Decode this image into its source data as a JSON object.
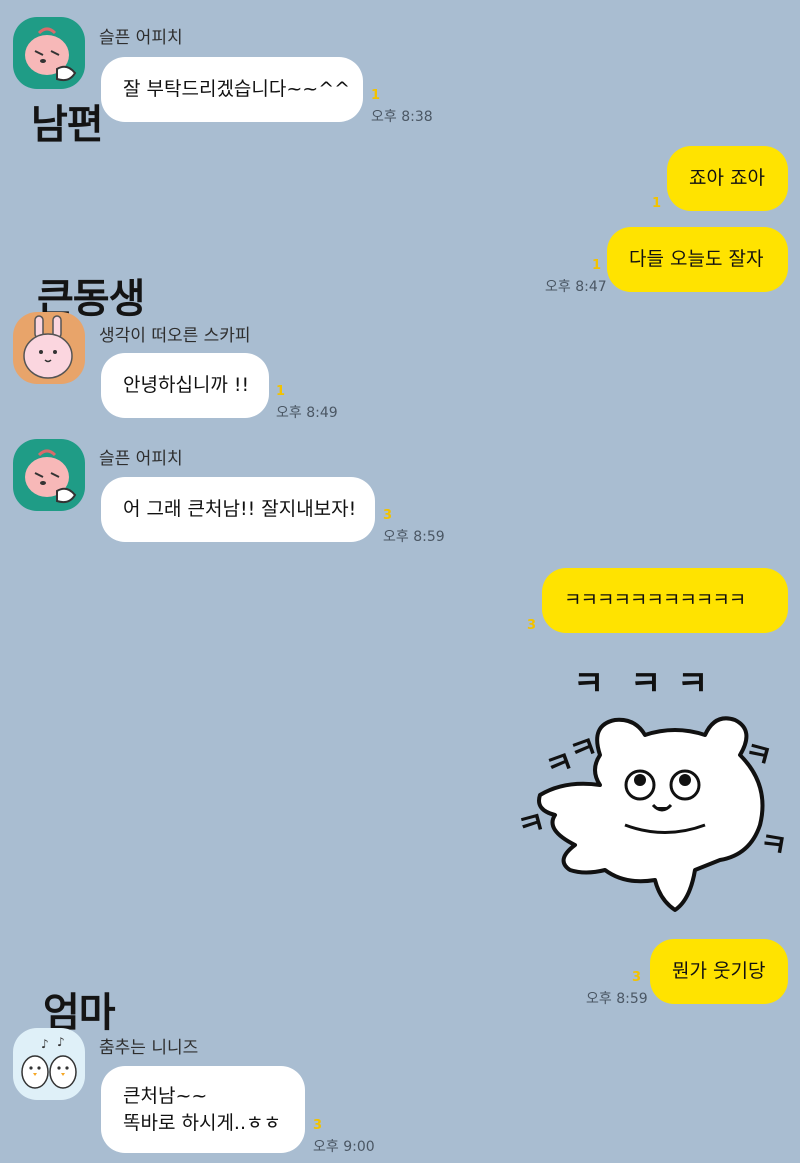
{
  "labels": {
    "husband": "남편",
    "older_sibling": "큰동생",
    "mom": "엄마"
  },
  "messages": {
    "m1": {
      "sender": "슬픈 어피치",
      "text": "잘 부탁드리겠습니다~~^^",
      "unread": "1",
      "time": "오후 8:38"
    },
    "m2": {
      "text": "죠아 죠아",
      "unread": "1"
    },
    "m3": {
      "text": "다들 오늘도 잘자",
      "unread": "1",
      "time": "오후 8:47"
    },
    "m4": {
      "sender": "생각이 떠오른 스카피",
      "text": "안녕하십니까 !!",
      "unread": "1",
      "time": "오후 8:49"
    },
    "m5": {
      "sender": "슬픈 어피치",
      "text": "어 그래 큰처남!! 잘지내보자!",
      "unread": "3",
      "time": "오후 8:59"
    },
    "m6": {
      "text": "ㅋㅋㅋㅋㅋㅋㅋㅋㅋㅋㅋ",
      "unread": "3"
    },
    "sticker": {
      "texts": [
        "ㅋ",
        "ㅋ",
        "ㅋ",
        "ㅋ",
        "ㅋ",
        "ㅋ",
        "ㅋ",
        "ㅋ"
      ]
    },
    "m7": {
      "text": "뭔가 웃기당",
      "unread": "3",
      "time": "오후 8:59"
    },
    "m8": {
      "sender": "춤추는 니니즈",
      "line1": "큰처남~~",
      "line2": "똑바로 하시게..ㅎㅎ",
      "unread": "3",
      "time": "오후 9:00"
    }
  },
  "colors": {
    "background": "#a9bdd1",
    "incoming": "#ffffff",
    "outgoing": "#ffe300",
    "unread": "#f2c200"
  }
}
